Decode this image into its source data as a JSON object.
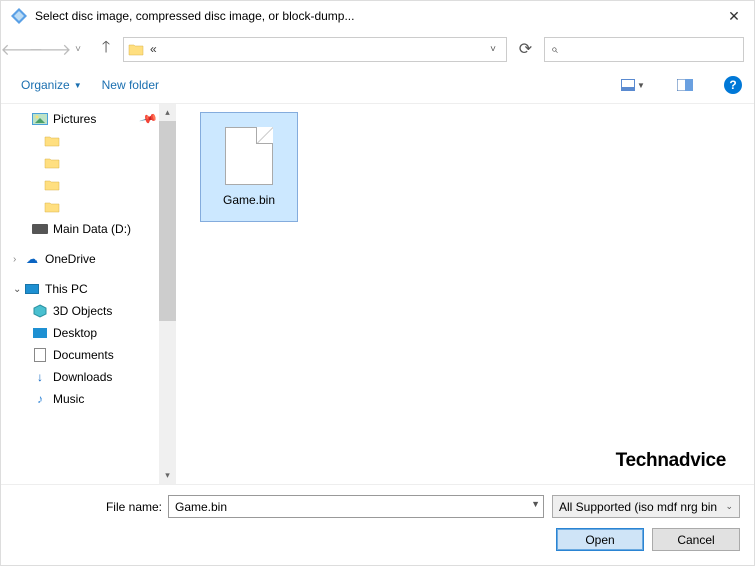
{
  "titlebar": {
    "title": "Select disc image, compressed disc image, or block-dump..."
  },
  "nav": {
    "breadcrumb": "«"
  },
  "toolbar": {
    "organize": "Organize",
    "new_folder": "New folder"
  },
  "tree": {
    "pictures": "Pictures",
    "main_data": "Main Data (D:)",
    "onedrive": "OneDrive",
    "this_pc": "This PC",
    "objects3d": "3D Objects",
    "desktop": "Desktop",
    "documents": "Documents",
    "downloads": "Downloads",
    "music": "Music"
  },
  "files": {
    "selected": "Game.bin"
  },
  "footer": {
    "filename_label": "File name:",
    "filename_value": "Game.bin",
    "filter": "All Supported (iso mdf nrg bin",
    "open": "Open",
    "cancel": "Cancel"
  },
  "watermark": "Technadvice"
}
